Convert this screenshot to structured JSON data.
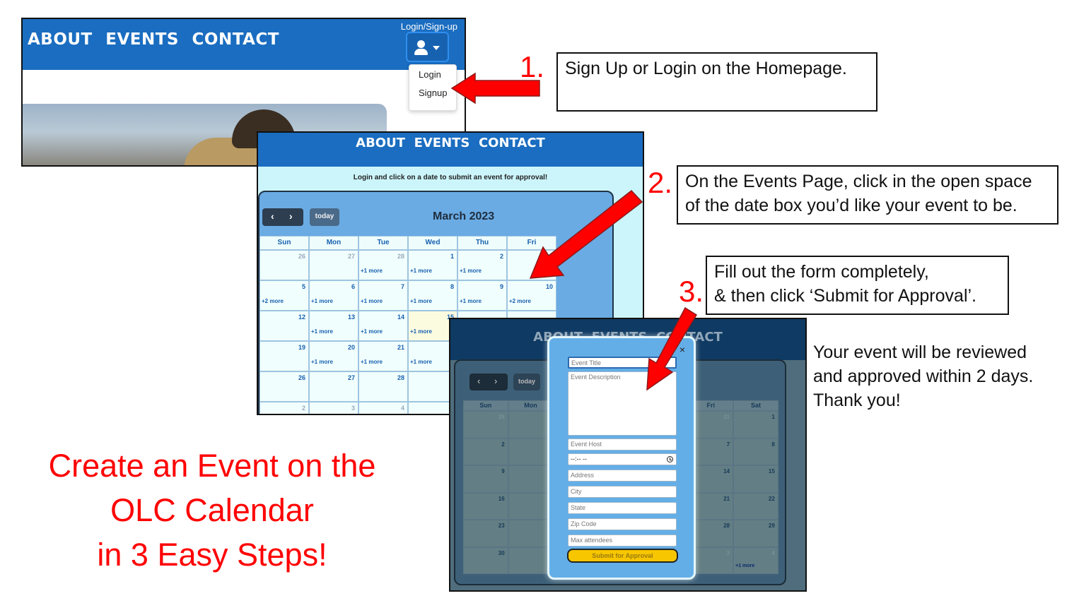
{
  "nav": {
    "about": "ABOUT",
    "events": "EVENTS",
    "contact": "CONTACT"
  },
  "shot1": {
    "login_signup_label": "Login/Sign-up",
    "dropdown": {
      "login": "Login",
      "signup": "Signup"
    }
  },
  "shot2": {
    "subtitle": "Login and click on a date to submit an event for approval!",
    "today": "today",
    "month": "March 2023",
    "days": [
      "Sun",
      "Mon",
      "Tue",
      "Wed",
      "Thu",
      "Fri"
    ],
    "rows": [
      [
        [
          "26",
          "",
          true
        ],
        [
          "27",
          "",
          true
        ],
        [
          "28",
          "+1 more",
          true
        ],
        [
          "1",
          "+1 more",
          false
        ],
        [
          "2",
          "+1 more",
          false
        ],
        [
          "",
          "",
          false
        ]
      ],
      [
        [
          "5",
          "+2 more",
          false
        ],
        [
          "6",
          "+1 more",
          false
        ],
        [
          "7",
          "+1 more",
          false
        ],
        [
          "8",
          "+1 more",
          false
        ],
        [
          "9",
          "+1 more",
          false
        ],
        [
          "10",
          "+2 more",
          false
        ]
      ],
      [
        [
          "12",
          "",
          false
        ],
        [
          "13",
          "+1 more",
          false
        ],
        [
          "14",
          "+1 more",
          false
        ],
        [
          "15",
          "+1 more",
          false
        ],
        [
          "",
          "",
          false
        ],
        [
          "",
          "",
          false
        ]
      ],
      [
        [
          "19",
          "",
          false
        ],
        [
          "20",
          "+1 more",
          false
        ],
        [
          "21",
          "+1 more",
          false
        ],
        [
          "2",
          "+1 more",
          false
        ],
        [
          "",
          "",
          false
        ],
        [
          "",
          "",
          false
        ]
      ],
      [
        [
          "26",
          "",
          false
        ],
        [
          "27",
          "",
          false
        ],
        [
          "28",
          "",
          false
        ],
        [
          "",
          "",
          false
        ],
        [
          "",
          "",
          false
        ],
        [
          "",
          "",
          false
        ]
      ],
      [
        [
          "2",
          "",
          true
        ],
        [
          "3",
          "",
          true
        ],
        [
          "4",
          "",
          true
        ],
        [
          "",
          "",
          false
        ],
        [
          "",
          "",
          false
        ],
        [
          "",
          "",
          false
        ]
      ]
    ]
  },
  "shot3": {
    "today": "today",
    "days": [
      "Sun",
      "Mon",
      "",
      "",
      "",
      "Fri",
      "Sat"
    ],
    "rows": [
      [
        [
          "26",
          "",
          true
        ],
        [
          "",
          "",
          false
        ],
        [
          "",
          "",
          false
        ],
        [
          "",
          "",
          false
        ],
        [
          "",
          "",
          false
        ],
        [
          "31",
          "",
          true
        ],
        [
          "1",
          "",
          false
        ]
      ],
      [
        [
          "2",
          "",
          false
        ],
        [
          "",
          "",
          false
        ],
        [
          "",
          "",
          false
        ],
        [
          "",
          "",
          false
        ],
        [
          "",
          "",
          false
        ],
        [
          "7",
          "",
          false
        ],
        [
          "8",
          "",
          false
        ]
      ],
      [
        [
          "9",
          "",
          false
        ],
        [
          "",
          "",
          false
        ],
        [
          "",
          "",
          false
        ],
        [
          "",
          "",
          false
        ],
        [
          "",
          "",
          false
        ],
        [
          "14",
          "",
          false
        ],
        [
          "15",
          "",
          false
        ]
      ],
      [
        [
          "16",
          "",
          false
        ],
        [
          "",
          "",
          false
        ],
        [
          "",
          "",
          false
        ],
        [
          "",
          "",
          false
        ],
        [
          "",
          "",
          false
        ],
        [
          "21",
          "",
          false
        ],
        [
          "22",
          "",
          false
        ]
      ],
      [
        [
          "23",
          "",
          false
        ],
        [
          "",
          "",
          false
        ],
        [
          "",
          "",
          false
        ],
        [
          "",
          "",
          false
        ],
        [
          "",
          "",
          false
        ],
        [
          "28",
          "",
          false
        ],
        [
          "29",
          "",
          false
        ]
      ],
      [
        [
          "30",
          "",
          false
        ],
        [
          "",
          "",
          false
        ],
        [
          "",
          "",
          false
        ],
        [
          "",
          "",
          false
        ],
        [
          "",
          "",
          false
        ],
        [
          "3",
          "",
          true
        ],
        [
          "4",
          "+1 more",
          true
        ]
      ]
    ],
    "form": {
      "event_title": "Event Title",
      "event_description": "Event Description",
      "event_host": "Event Host",
      "time": "--:-- --",
      "address": "Address",
      "city": "City",
      "state": "State",
      "zip": "Zip Code",
      "max_attendees": "Max attendees",
      "submit": "Submit for Approval",
      "close": "×"
    }
  },
  "steps": {
    "step1_num": "1.",
    "step1_text": "Sign Up or Login on the Homepage.",
    "step2_num": "2.",
    "step2_text": "On the Events Page, click in the open space of the date box you’d like your event to be.",
    "step3_num": "3.",
    "step3_line1": "Fill out the form completely,",
    "step3_line2": "& then click ‘Submit for Approval’.",
    "thanks_line1": "Your event will be reviewed",
    "thanks_line2": "and approved within 2 days.",
    "thanks_line3": "Thank you!"
  },
  "title": {
    "line1": "Create an Event on the",
    "line2": "OLC Calendar",
    "line3": "in 3 Easy Steps!"
  },
  "colors": {
    "nav_blue": "#1a6dc0",
    "accent_red": "#ff0000",
    "calendar_bg": "#6aabe4",
    "submit_yellow": "#f7c600"
  }
}
